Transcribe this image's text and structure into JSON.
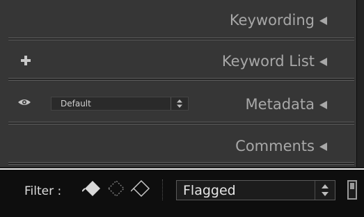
{
  "panels": [
    {
      "title": "Keywording"
    },
    {
      "title": "Keyword List"
    },
    {
      "title": "Metadata",
      "preset": "Default"
    },
    {
      "title": "Comments"
    }
  ],
  "filter_bar": {
    "label": "Filter :",
    "flag_filters": [
      "flagged-icon",
      "unflagged-icon",
      "rejected-icon"
    ],
    "selected": "Flagged"
  },
  "icons": {
    "collapse": "triangle-left-icon",
    "add": "plus-icon",
    "visibility": "eye-icon",
    "stepper": "updown-arrows-icon",
    "filter_toggle": "switch-icon"
  },
  "colors": {
    "panel_bg": "#363636",
    "panel_text": "#a8a8a8",
    "filter_bar_bg": "#0e0e0e",
    "filter_text": "#e6e6e6"
  }
}
